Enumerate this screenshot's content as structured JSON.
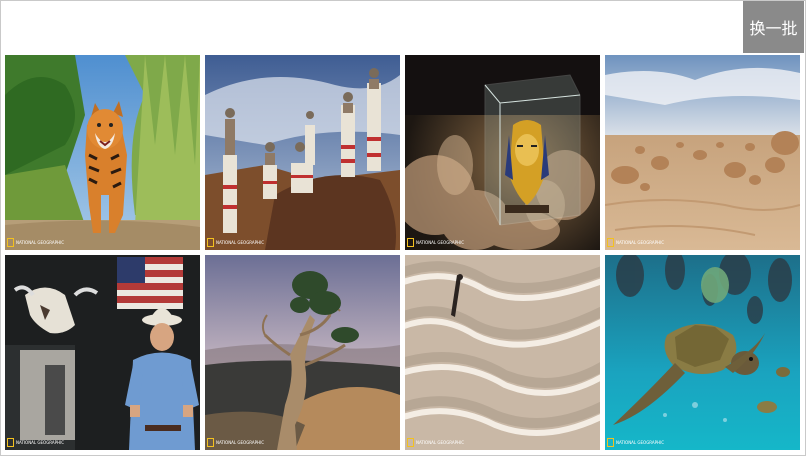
{
  "refresh_button": {
    "label": "换一批"
  },
  "tiles": [
    {
      "subject": "tiger in grassland",
      "logo": "NATIONAL GEOGRAPHIC"
    },
    {
      "subject": "wrapped figures on rocks",
      "logo": "NATIONAL GEOGRAPHIC"
    },
    {
      "subject": "golden mask in glass case",
      "logo": "NATIONAL GEOGRAPHIC"
    },
    {
      "subject": "desert rock formations",
      "logo": "NATIONAL GEOGRAPHIC"
    },
    {
      "subject": "cowboy with cattle and flag",
      "logo": "NATIONAL GEOGRAPHIC"
    },
    {
      "subject": "gnarled pine tree",
      "logo": "NATIONAL GEOGRAPHIC"
    },
    {
      "subject": "aerial sand dunes",
      "logo": "NATIONAL GEOGRAPHIC"
    },
    {
      "subject": "sea turtle underwater",
      "logo": "NATIONAL GEOGRAPHIC"
    }
  ]
}
